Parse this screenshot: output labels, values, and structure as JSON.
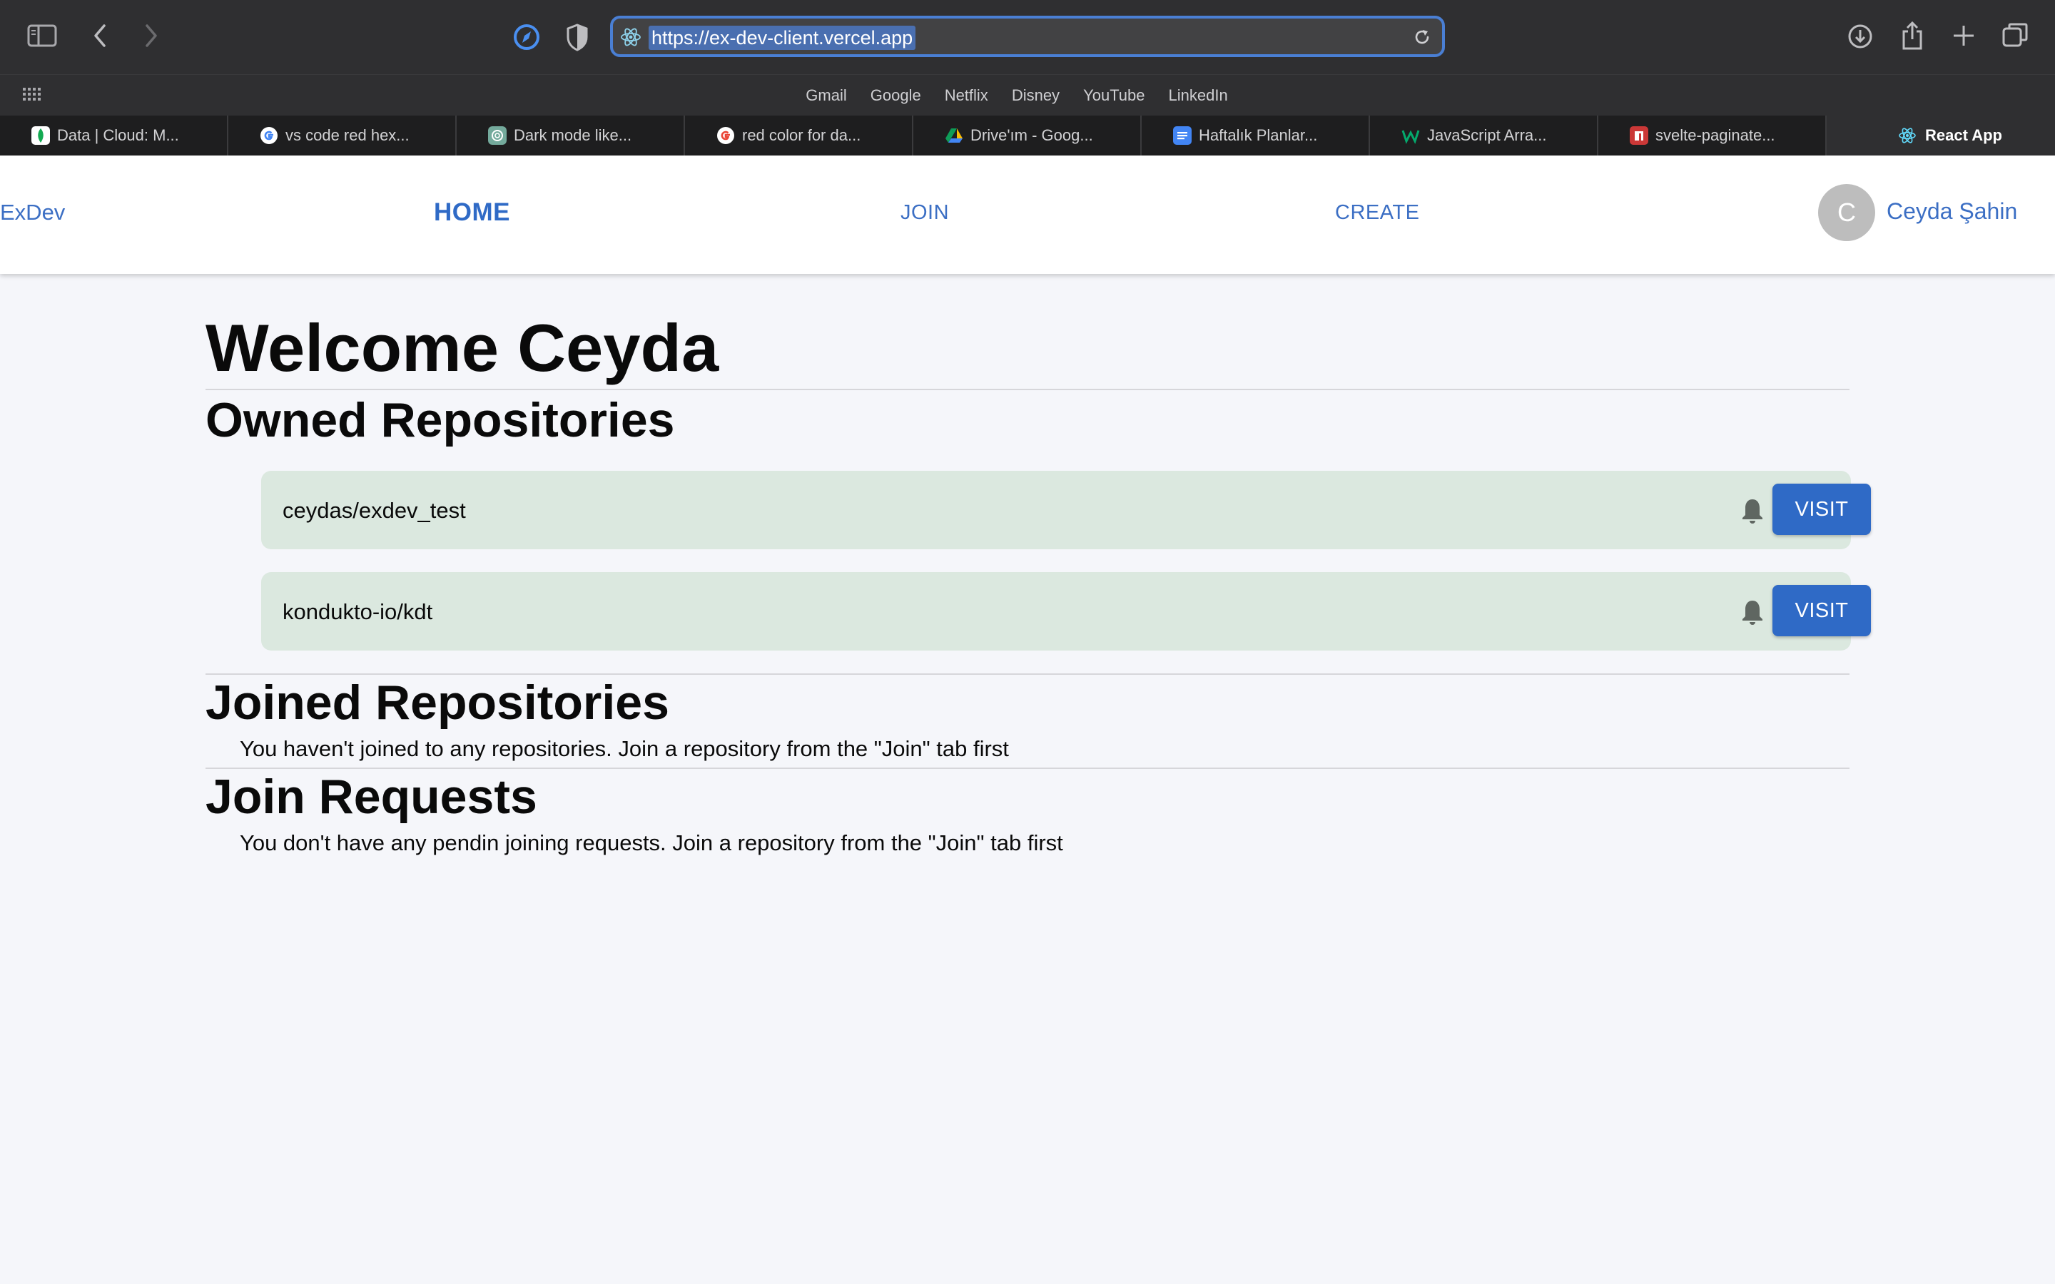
{
  "browser": {
    "url": "https://ex-dev-client.vercel.app",
    "bookmarks": [
      "Gmail",
      "Google",
      "Netflix",
      "Disney",
      "YouTube",
      "LinkedIn"
    ],
    "tabs": [
      {
        "label": "Data | Cloud: M...",
        "icon": "mongodb-leaf-icon",
        "color": "#13aa52"
      },
      {
        "label": "vs code red hex...",
        "icon": "google-g-icon",
        "color": "#ffffff"
      },
      {
        "label": "Dark mode like...",
        "icon": "chatgpt-icon",
        "color": "#74aa9c"
      },
      {
        "label": "red color for da...",
        "icon": "google-g-icon",
        "color": "#ffffff"
      },
      {
        "label": "Drive'ım - Goog...",
        "icon": "google-drive-icon",
        "color": "#fbbc04"
      },
      {
        "label": "Haftalık Planlar...",
        "icon": "google-docs-icon",
        "color": "#4285f4"
      },
      {
        "label": "JavaScript Arra...",
        "icon": "w3schools-icon",
        "color": "#04aa6d"
      },
      {
        "label": "svelte-paginate...",
        "icon": "npm-icon",
        "color": "#cb3837"
      },
      {
        "label": "React App",
        "icon": "react-icon",
        "color": "#61dafb",
        "active": true
      }
    ]
  },
  "header": {
    "brand": "ExDev",
    "nav": {
      "home": "HOME",
      "join": "JOIN",
      "create": "CREATE"
    },
    "avatar_initial": "C",
    "user_name": "Ceyda Şahin"
  },
  "main": {
    "welcome": "Welcome Ceyda",
    "owned_title": "Owned Repositories",
    "owned_repos": [
      {
        "name": "ceydas/exdev_test",
        "button": "VISIT"
      },
      {
        "name": "kondukto-io/kdt",
        "button": "VISIT"
      }
    ],
    "joined_title": "Joined Repositories",
    "joined_empty": "You haven't joined to any repositories. Join a repository from the \"Join\" tab first",
    "requests_title": "Join Requests",
    "requests_empty": "You don't have any pendin joining requests. Join a repository from the \"Join\" tab first"
  },
  "colors": {
    "accent": "#2f6ac6",
    "card": "#dbe8df",
    "page_bg": "#f5f6fa"
  }
}
